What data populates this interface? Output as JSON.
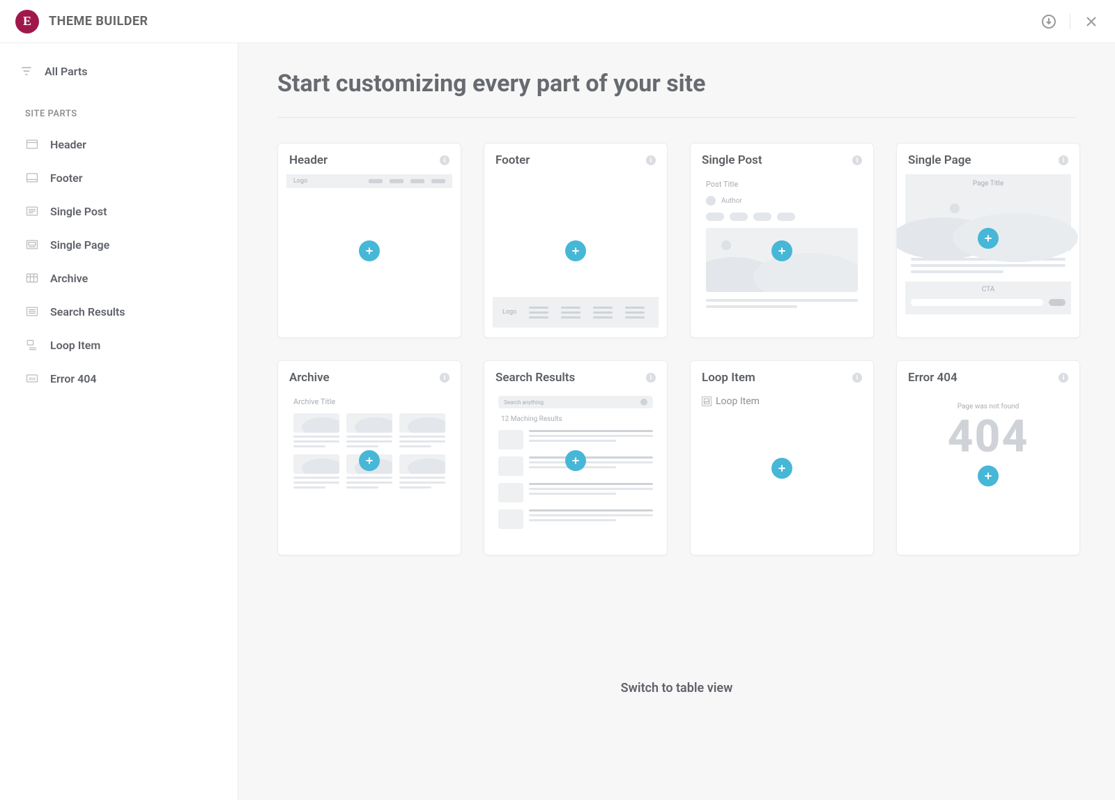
{
  "header": {
    "app_title": "THEME BUILDER"
  },
  "sidebar": {
    "all_parts": "All Parts",
    "section_heading": "SITE PARTS",
    "items": [
      {
        "label": "Header"
      },
      {
        "label": "Footer"
      },
      {
        "label": "Single Post"
      },
      {
        "label": "Single Page"
      },
      {
        "label": "Archive"
      },
      {
        "label": "Search Results"
      },
      {
        "label": "Loop Item"
      },
      {
        "label": "Error 404"
      }
    ]
  },
  "main": {
    "title": "Start customizing every part of your site",
    "switch_view": "Switch to table view",
    "cards": [
      {
        "title": "Header"
      },
      {
        "title": "Footer"
      },
      {
        "title": "Single Post"
      },
      {
        "title": "Single Page"
      },
      {
        "title": "Archive"
      },
      {
        "title": "Search Results"
      },
      {
        "title": "Loop Item"
      },
      {
        "title": "Error 404"
      }
    ],
    "preview": {
      "header_logo": "Logo",
      "footer_logo": "Logo",
      "post_title": "Post Title",
      "post_author": "Author",
      "page_title": "Page Title",
      "page_cta": "CTA",
      "archive_title": "Archive Title",
      "search_placeholder": "Search anything",
      "search_count": "12 Maching Results",
      "loop_alt": "Loop Item",
      "e404_text": "Page was not found",
      "e404_code": "404"
    }
  }
}
